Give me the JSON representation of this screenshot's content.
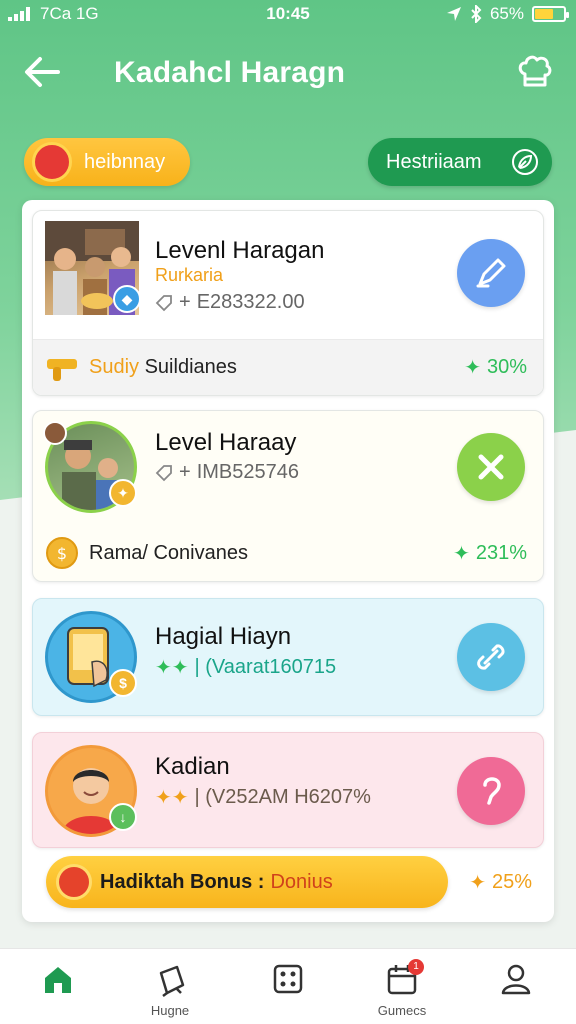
{
  "status_bar": {
    "carrier": "7Ca 1G",
    "time": "10:45",
    "battery": "65%"
  },
  "header": {
    "title": "Kadahcl Haragn",
    "back_icon": "arrow-left-icon",
    "settings_icon": "chef-hat-icon"
  },
  "chips": {
    "left_label": "heibnnay",
    "right_label": "Hestriiaam"
  },
  "cards": [
    {
      "title": "Levenl Haragan",
      "subtitle": "Rurkaria",
      "meta": "E283322.00",
      "footer_label_accent": "Sudiy",
      "footer_label": "Suildianes",
      "percent": "30%",
      "action_color": "#6a9ff1",
      "action_icon": "pencil-icon"
    },
    {
      "title": "Level Haraay",
      "meta": "IMB525746",
      "footer_label": "Rama/ Conivanes",
      "percent": "231%",
      "action_color": "#8bd14a",
      "action_icon": "close-icon"
    },
    {
      "title": "Hagial Hiayn",
      "meta": "| (Vaarat160715",
      "action_color": "#5cc0e4",
      "action_icon": "link-icon"
    },
    {
      "title": "Kadian",
      "meta": "| (V252AM H6207%",
      "action_color": "#f06a96",
      "action_icon": "hook-icon"
    }
  ],
  "bonus": {
    "label": "Hadiktah Bonus :",
    "label2": "Donius",
    "percent": "25%"
  },
  "nav": [
    {
      "label": "",
      "icon": "home-icon"
    },
    {
      "label": "Hugne",
      "icon": "bag-icon"
    },
    {
      "label": "",
      "icon": "dice-icon"
    },
    {
      "label": "Gumecs",
      "icon": "calendar-icon",
      "badge": "1"
    },
    {
      "label": "",
      "icon": "profile-icon"
    }
  ]
}
